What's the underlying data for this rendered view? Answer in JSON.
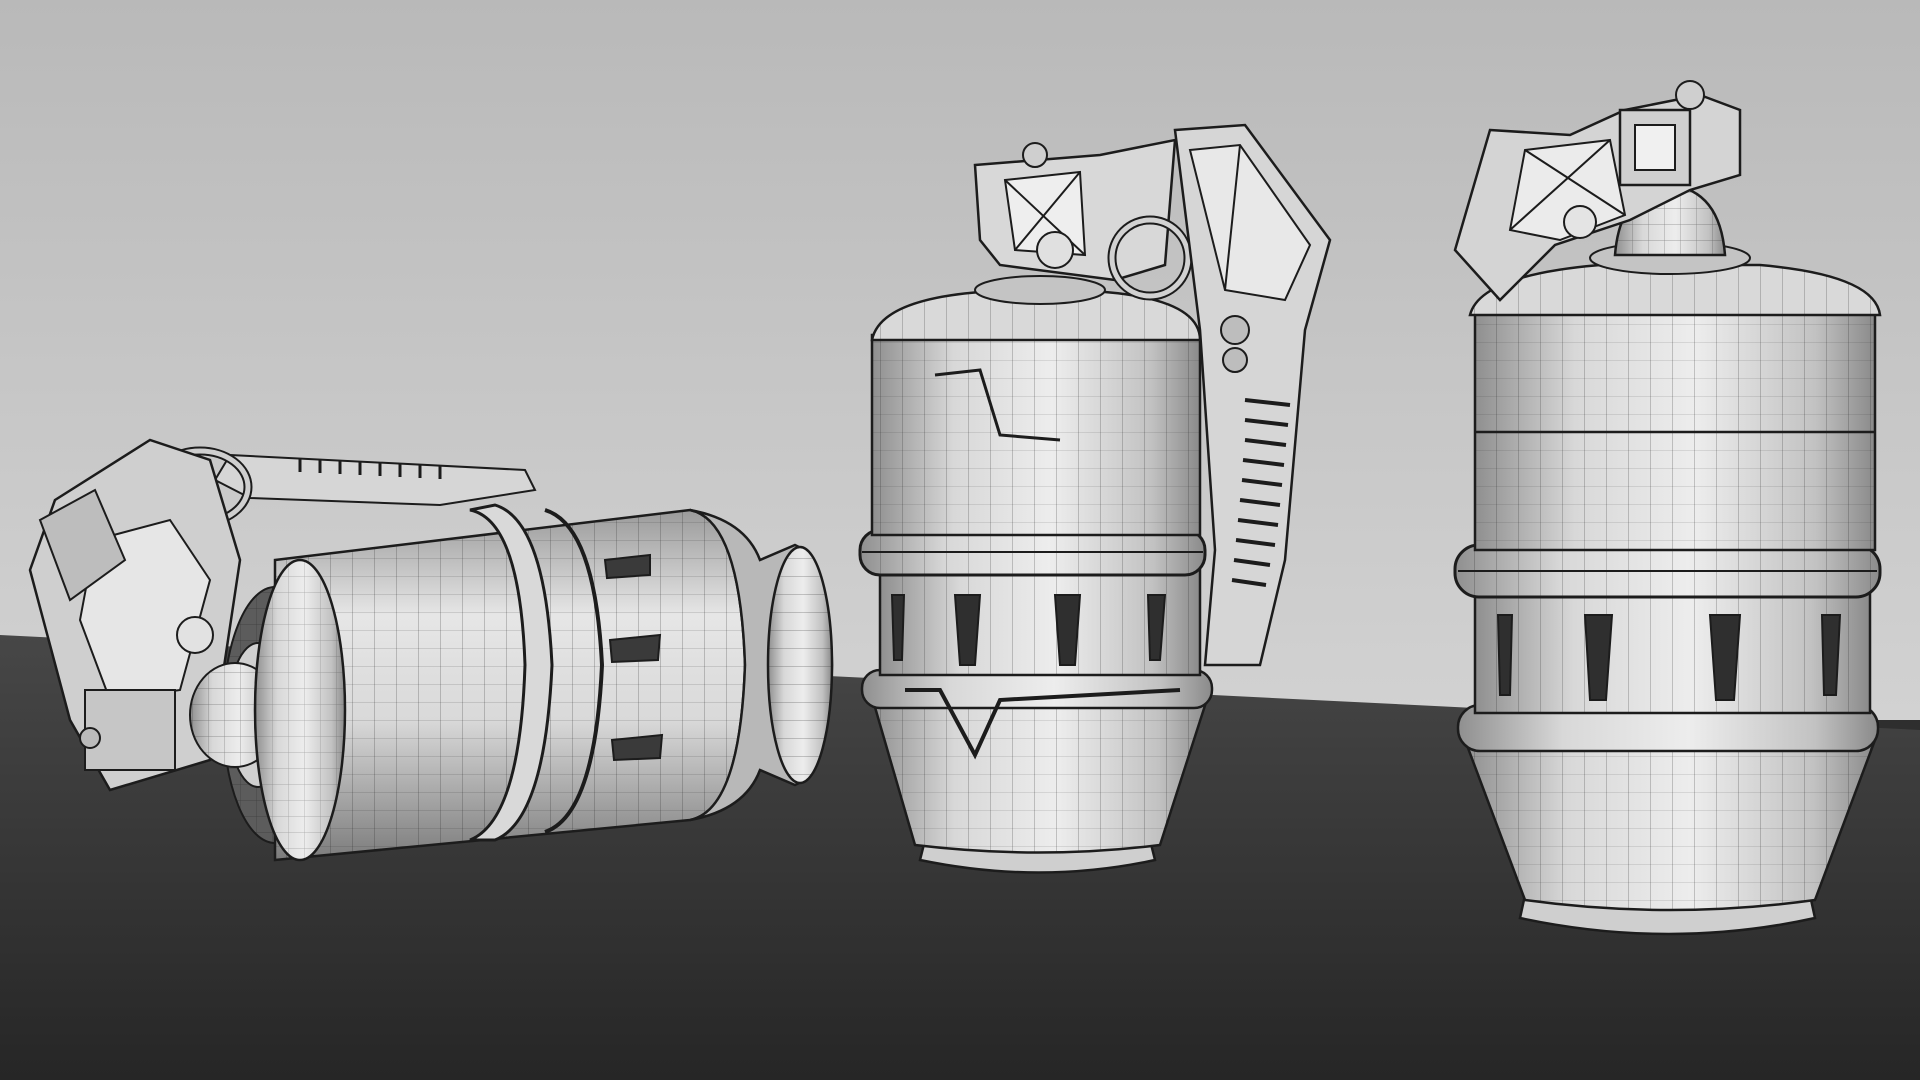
{
  "scene": {
    "render_style": "wireframe-on-shaded",
    "objects": [
      {
        "name": "grenade-lying",
        "orientation": "horizontal"
      },
      {
        "name": "grenade-with-lever",
        "orientation": "upright"
      },
      {
        "name": "grenade-upright",
        "orientation": "upright"
      }
    ],
    "colors": {
      "backdrop_top": "#bcbcbc",
      "backdrop_bottom": "#cdcdcd",
      "floor_near": "#2a2a2a",
      "floor_far": "#454545",
      "mesh_fill_light": "#e4e4e4",
      "mesh_fill_mid": "#c9c9c9",
      "mesh_fill_dark": "#9a9a9a",
      "wire": "#1c1c1c"
    }
  }
}
